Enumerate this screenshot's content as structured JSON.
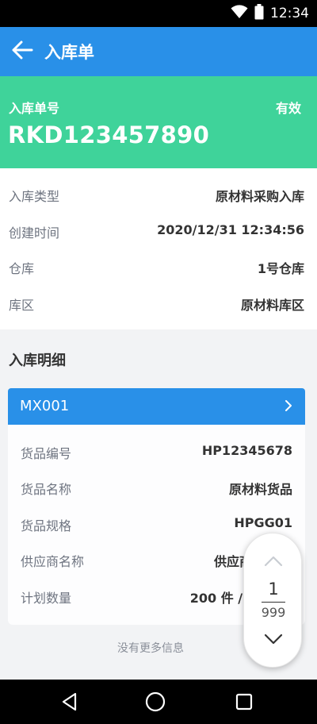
{
  "status_bar": {
    "time": "12:34",
    "icons": [
      "wifi-icon",
      "battery-icon"
    ]
  },
  "app_bar": {
    "back_icon": "arrow-left-icon",
    "title": "入库单"
  },
  "header": {
    "label": "入库单号",
    "status": "有效",
    "number": "RKD123457890"
  },
  "info": [
    {
      "key": "入库类型",
      "value": "原材料采购入库"
    },
    {
      "key": "创建时间",
      "value": "2020/12/31 12:34:56"
    },
    {
      "key": "仓库",
      "value": "1号仓库"
    },
    {
      "key": "库区",
      "value": "原材料库区"
    }
  ],
  "section_title": "入库明细",
  "detail": {
    "code": "MX001",
    "rows": [
      {
        "key": "货品编号",
        "value": "HP12345678"
      },
      {
        "key": "货品名称",
        "value": "原材料货品"
      },
      {
        "key": "货品规格",
        "value": "HPGG01"
      },
      {
        "key": "供应商名称",
        "value": "供应商全"
      },
      {
        "key": "计划数量",
        "value": "200 件 / 60"
      }
    ]
  },
  "no_more": "没有更多信息",
  "pager": {
    "current": "1",
    "total": "999"
  },
  "colors": {
    "primary": "#2990e8",
    "success": "#3fd39a",
    "background": "#f2f3f5"
  },
  "nav_bar": {
    "icons": [
      "back-triangle-icon",
      "home-circle-icon",
      "recents-square-icon"
    ]
  }
}
